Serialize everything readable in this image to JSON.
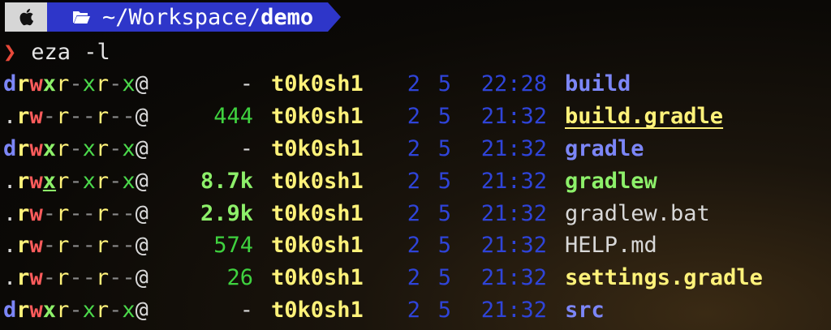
{
  "prompt": {
    "os_icon": "apple-icon",
    "folder_icon": "folder-icon",
    "path_prefix": "~/Workspace/",
    "path_dir": "demo",
    "symbol": "❯",
    "command": "eza -l"
  },
  "colors": {
    "path_segment_bg": "#2e36c9",
    "os_segment_bg": "#d6d6d6",
    "directory": "#7c86f7",
    "executable": "#8df06a",
    "user": "#fff27a",
    "date": "#2f44d8",
    "prompt_chevron": "#e8493a"
  },
  "columns": [
    "permissions",
    "size",
    "user",
    "month",
    "day",
    "time",
    "name"
  ],
  "files": [
    {
      "permissions": "drwxr-xr-x@",
      "size": "-",
      "user": "t0k0sh1",
      "month": "2",
      "day": "5",
      "time": "22:28",
      "name": "build",
      "kind": "dir"
    },
    {
      "permissions": ".rw-r--r--@",
      "size": "444",
      "user": "t0k0sh1",
      "month": "2",
      "day": "5",
      "time": "21:32",
      "name": "build.gradle",
      "kind": "build"
    },
    {
      "permissions": "drwxr-xr-x@",
      "size": "-",
      "user": "t0k0sh1",
      "month": "2",
      "day": "5",
      "time": "21:32",
      "name": "gradle",
      "kind": "dir"
    },
    {
      "permissions": ".rwxr-xr-x@",
      "size": "8.7k",
      "user": "t0k0sh1",
      "month": "2",
      "day": "5",
      "time": "21:32",
      "name": "gradlew",
      "kind": "exec"
    },
    {
      "permissions": ".rw-r--r--@",
      "size": "2.9k",
      "user": "t0k0sh1",
      "month": "2",
      "day": "5",
      "time": "21:32",
      "name": "gradlew.bat",
      "kind": "plain"
    },
    {
      "permissions": ".rw-r--r--@",
      "size": "574",
      "user": "t0k0sh1",
      "month": "2",
      "day": "5",
      "time": "21:32",
      "name": "HELP.md",
      "kind": "plain"
    },
    {
      "permissions": ".rw-r--r--@",
      "size": "26",
      "user": "t0k0sh1",
      "month": "2",
      "day": "5",
      "time": "21:32",
      "name": "settings.gradle",
      "kind": "settings"
    },
    {
      "permissions": "drwxr-xr-x@",
      "size": "-",
      "user": "t0k0sh1",
      "month": "2",
      "day": "5",
      "time": "21:32",
      "name": "src",
      "kind": "dir"
    }
  ]
}
